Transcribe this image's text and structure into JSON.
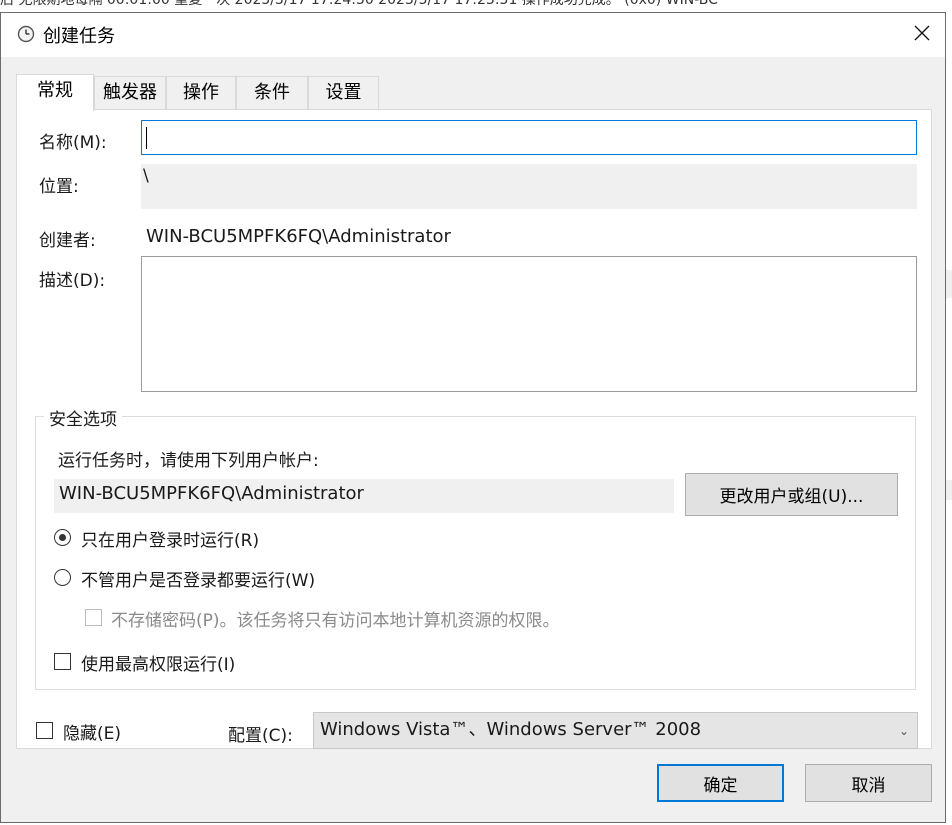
{
  "background": {
    "strip_text": "后    无限期地每隔 00:01:00 重复一次      2025/5/17 17:24:50    2025/5/17 17:23:51    操作成功完成。  (0x0)    WIN-BC"
  },
  "window": {
    "title": "创建任务",
    "title_icon": "clock-icon",
    "close_icon": "close-icon"
  },
  "tabs": [
    {
      "label": "常规"
    },
    {
      "label": "触发器"
    },
    {
      "label": "操作"
    },
    {
      "label": "条件"
    },
    {
      "label": "设置"
    }
  ],
  "general": {
    "name_label": "名称(M):",
    "name_value": "",
    "location_label": "位置:",
    "location_value": "\\",
    "author_label": "创建者:",
    "author_value": "WIN-BCU5MPFK6FQ\\Administrator",
    "description_label": "描述(D):",
    "description_value": ""
  },
  "security": {
    "legend": "安全选项",
    "run_as_label": "运行任务时，请使用下列用户帐户:",
    "run_as_value": "WIN-BCU5MPFK6FQ\\Administrator",
    "change_user_button": "更改用户或组(U)...",
    "radio_logged_on": {
      "label": "只在用户登录时运行(R)",
      "checked": true
    },
    "radio_whether_logged": {
      "label": "不管用户是否登录都要运行(W)",
      "checked": false
    },
    "no_store_password": {
      "label": "不存储密码(P)。该任务将只有访问本地计算机资源的权限。",
      "checked": false,
      "disabled": true
    },
    "highest_privileges": {
      "label": "使用最高权限运行(I)",
      "checked": false
    }
  },
  "footer": {
    "hidden_label": "隐藏(E)",
    "hidden_checked": false,
    "configure_label": "配置(C):",
    "configure_value": "Windows Vista™、Windows Server™ 2008"
  },
  "buttons": {
    "ok": "确定",
    "cancel": "取消"
  },
  "colors": {
    "accent": "#0078d7",
    "dialog_bg": "#f0f0f0",
    "panel_bg": "#ffffff"
  }
}
